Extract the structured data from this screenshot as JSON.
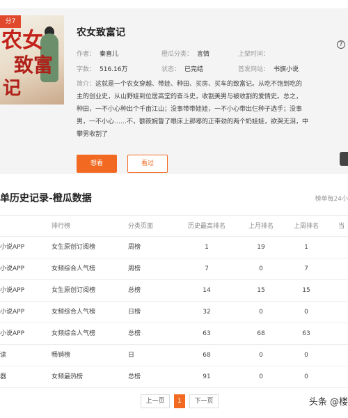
{
  "book": {
    "cover": {
      "ribbon": "分7",
      "line1": "农女",
      "line2": "致富",
      "line3": "记"
    },
    "title": "农女致富记",
    "author_label": "作者：",
    "author": "秦喜儿",
    "category_label": "橙瓜分类：",
    "category": "言情",
    "listed_label": "上架时间：",
    "listed": "",
    "words_label": "字数：",
    "words": "516.16万",
    "status_label": "状态：",
    "status": "已完结",
    "site_label": "首发网站：",
    "site": "书旗小说",
    "synopsis_label": "简介：",
    "synopsis_lines": [
      "这就是一个农女穿越、带娃、种田、买房、买车的致富记。从吃不饱到吃的",
      "主的创业史，从山野娃到位居高堂的奋斗史，收割美男与被收割的爱情史。总之，",
      "种田，一不小心种出个千亩江山；没事带带娃娃，一不小心带出仨种子选手；没事",
      "男，一不小心……不，额筱婉瞥了眼床上那嘟的正带劲的两个奶娃娃，欲哭无泪，中",
      "攀男收割了"
    ],
    "want_button": "想看",
    "read_button": "看过",
    "help_icon": "?"
  },
  "history": {
    "title": "单历史记录-橙瓜数据",
    "note": "榜单每24小",
    "columns": [
      "",
      "排行榜",
      "分类页面",
      "历史最高排名",
      "上月排名",
      "上周排名",
      "当"
    ],
    "rows": [
      [
        "小说APP",
        "女生原创订阅榜",
        "周榜",
        "1",
        "19",
        "1",
        ""
      ],
      [
        "小说APP",
        "女频综合人气榜",
        "周榜",
        "7",
        "0",
        "7",
        ""
      ],
      [
        "小说APP",
        "女生原创订阅榜",
        "总榜",
        "14",
        "15",
        "15",
        ""
      ],
      [
        "小说APP",
        "女频综合人气榜",
        "日榜",
        "32",
        "0",
        "0",
        ""
      ],
      [
        "小说APP",
        "女频综合人气榜",
        "总榜",
        "63",
        "68",
        "63",
        ""
      ],
      [
        "读",
        "畅销榜",
        "日",
        "68",
        "0",
        "0",
        ""
      ],
      [
        "器",
        "女频最热榜",
        "总榜",
        "91",
        "0",
        "0",
        ""
      ]
    ]
  },
  "pagination": {
    "prev": "上一页",
    "current": "1",
    "next": "下一页"
  },
  "watermark": "头条 @楼",
  "colors": {
    "accent": "#f26a21",
    "card_bg": "#f4f4f5"
  }
}
